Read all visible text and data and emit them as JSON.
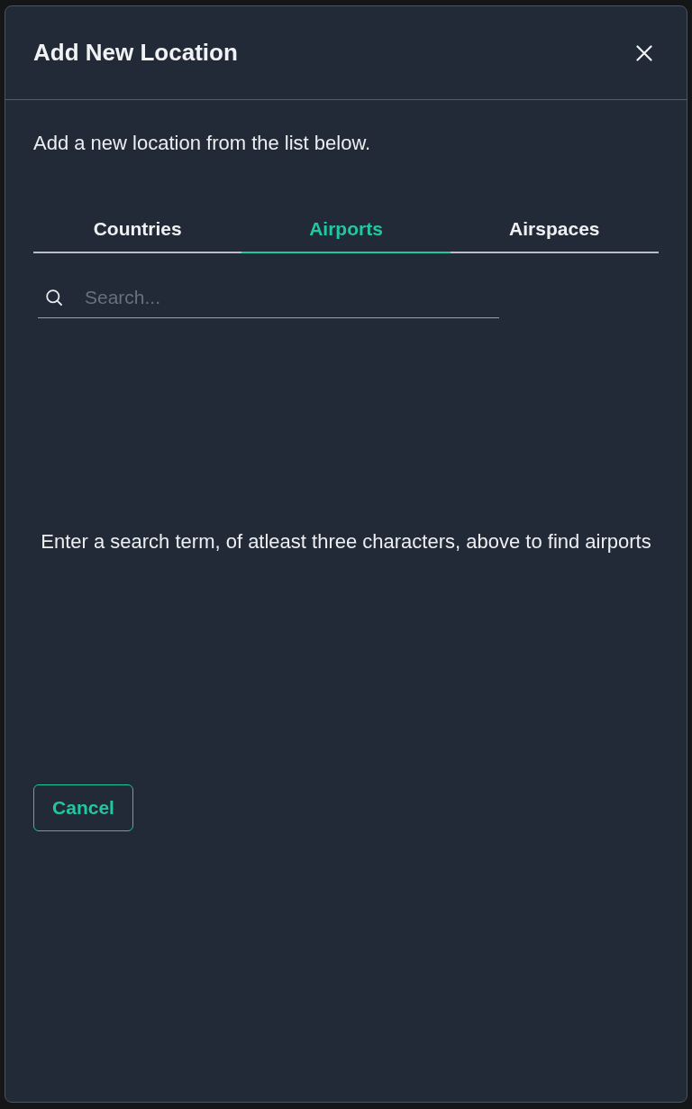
{
  "dialog": {
    "title": "Add New Location",
    "description": "Add a new location from the list below."
  },
  "tabs": [
    {
      "label": "Countries",
      "selected": false
    },
    {
      "label": "Airports",
      "selected": true
    },
    {
      "label": "Airspaces",
      "selected": false
    }
  ],
  "search": {
    "placeholder": "Search..."
  },
  "empty_message": "Enter a search term, of atleast three characters, above to find airports",
  "buttons": [
    {
      "label": "Cancel",
      "kind": "outline"
    }
  ]
}
